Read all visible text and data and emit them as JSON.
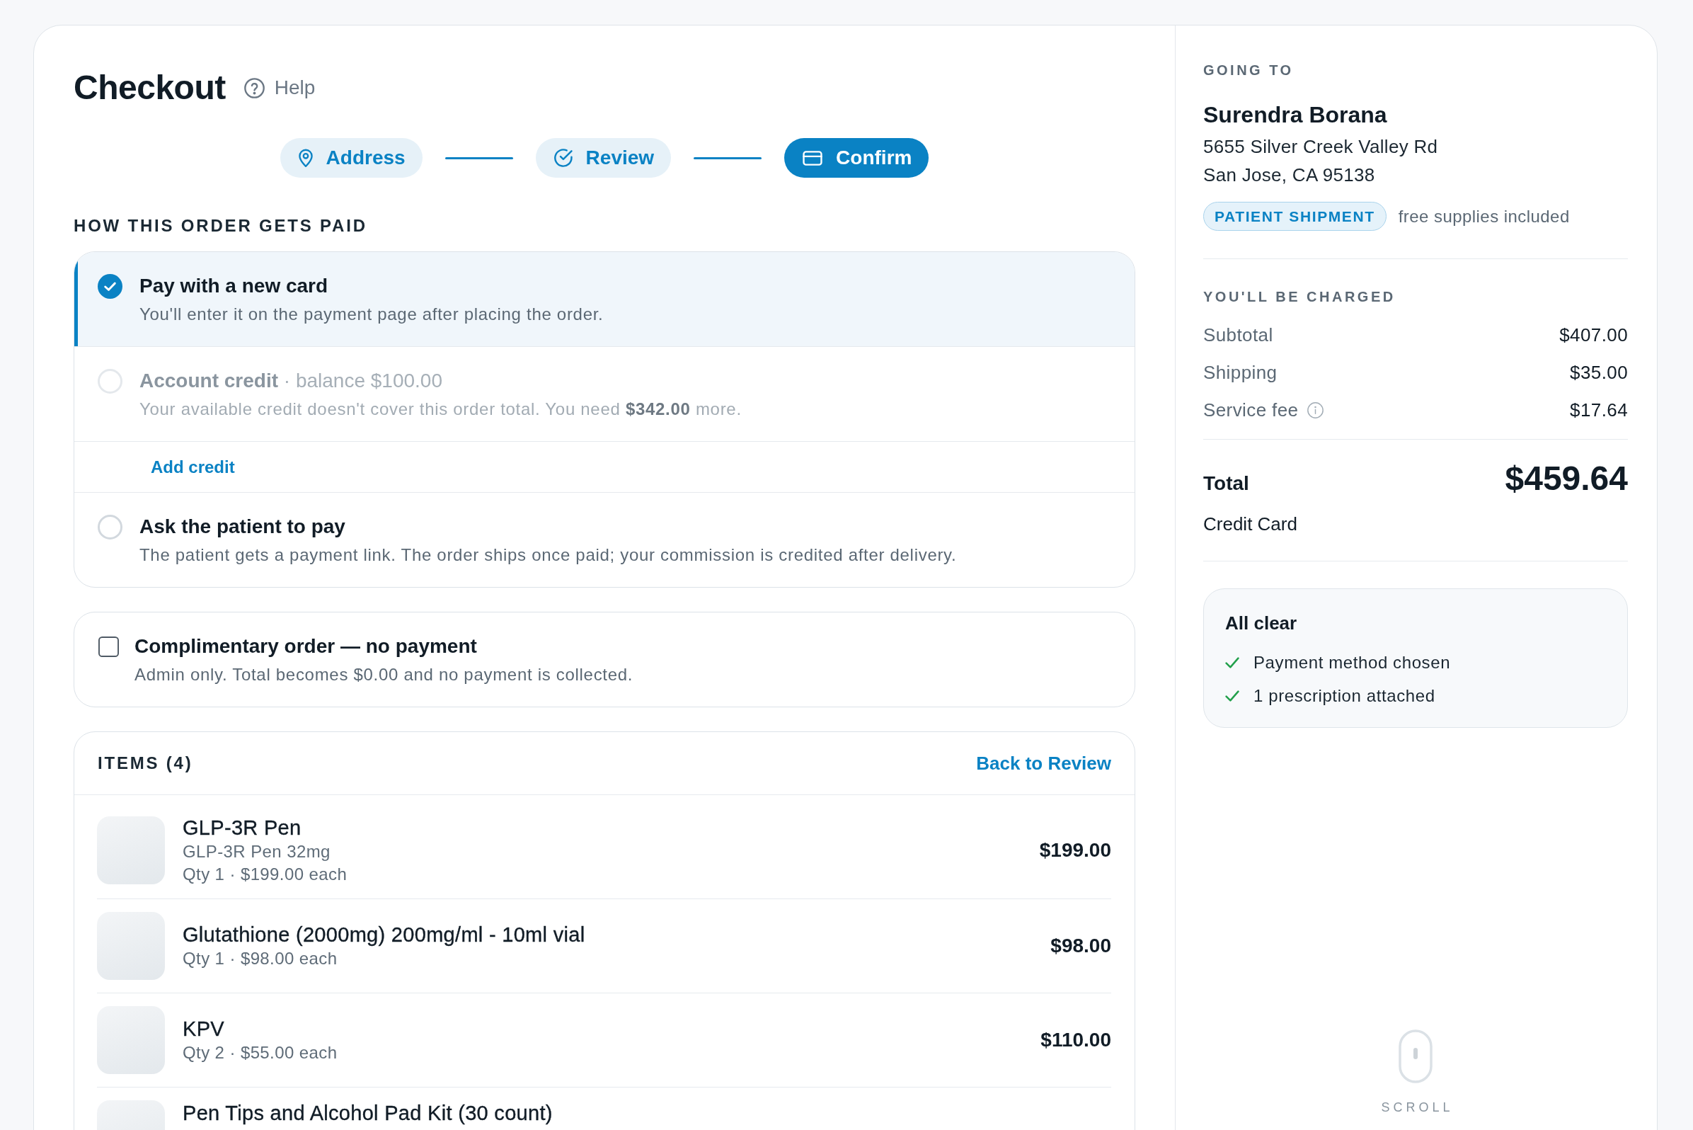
{
  "header": {
    "title": "Checkout",
    "help": "Help"
  },
  "steps": [
    {
      "label": "Address",
      "selected": false
    },
    {
      "label": "Review",
      "selected": false
    },
    {
      "label": "Confirm",
      "selected": true
    }
  ],
  "payment": {
    "heading": "HOW THIS ORDER GETS PAID",
    "options": [
      {
        "title": "Pay with a new card",
        "description": "You'll enter it on the payment page after placing the order.",
        "selected": true,
        "disabled": false
      },
      {
        "title": "Account credit",
        "detail": "· balance $100.00",
        "description": "Your available credit doesn't cover this order total. You need **$342.00** more.",
        "selected": false,
        "disabled": true,
        "action": "Add credit"
      },
      {
        "title": "Ask the patient to pay",
        "description": "The patient gets a payment link. The order ships once paid; your commission is credited after delivery.",
        "selected": false,
        "disabled": false
      }
    ]
  },
  "complimentary": {
    "title": "Complimentary order — no payment",
    "description": "Admin only. Total becomes $0.00 and no payment is collected.",
    "checked": false
  },
  "items": {
    "heading": "ITEMS (4)",
    "link": "Back to Review",
    "rows": [
      {
        "title": "GLP-3R Pen",
        "lines": [
          "GLP-3R Pen 32mg",
          "Qty 1 · $199.00 each"
        ],
        "price": "$199.00"
      },
      {
        "title": "Glutathione (2000mg) 200mg/ml - 10ml vial",
        "lines": [
          "Qty 1 · $98.00 each"
        ],
        "price": "$98.00"
      },
      {
        "title": "KPV",
        "lines": [
          "Qty 2 · $55.00 each"
        ],
        "price": "$110.00"
      },
      {
        "title": "Pen Tips and Alcohol Pad Kit (30 count)"
      }
    ]
  },
  "shipping": {
    "heading": "GOING TO",
    "name": "Surendra Borana",
    "address": [
      "5655 Silver Creek Valley Rd",
      "San Jose, CA 95138"
    ],
    "tag": "PATIENT SHIPMENT",
    "note": "free supplies included"
  },
  "charges": {
    "heading": "YOU'LL BE CHARGED",
    "rows": [
      {
        "label": "Subtotal",
        "value": "$407.00",
        "info": false
      },
      {
        "label": "Shipping",
        "value": "$35.00",
        "info": false
      },
      {
        "label": "Service fee",
        "value": "$17.64",
        "info": true
      }
    ],
    "total_label": "Total",
    "total": "$459.64",
    "method": "Credit Card"
  },
  "checklist": {
    "title": "All clear",
    "items": [
      {
        "text": "Payment method chosen",
        "done": true
      },
      {
        "text": "1 prescription attached",
        "done": true
      }
    ]
  },
  "scroll_hint": "SCROLL"
}
